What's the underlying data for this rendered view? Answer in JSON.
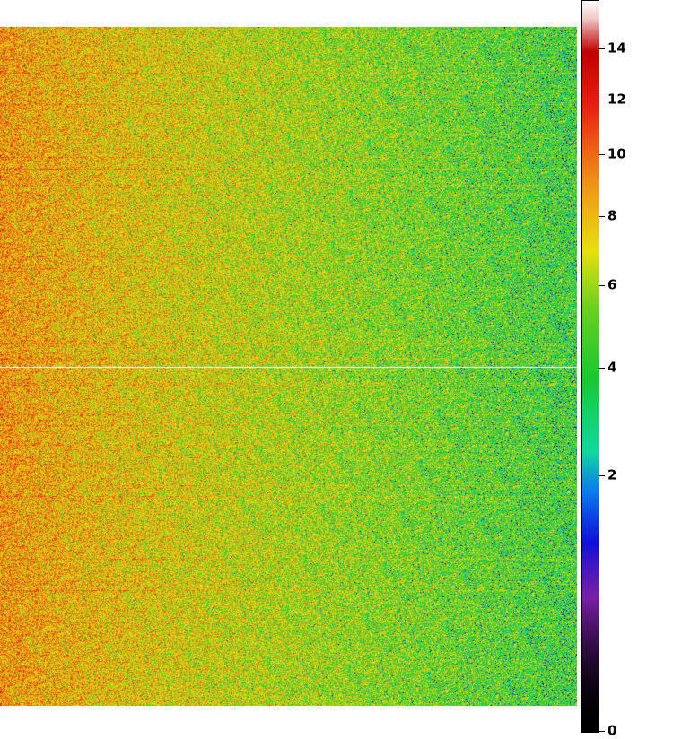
{
  "chart_data": {
    "type": "heatmap",
    "title": "",
    "xlabel": "",
    "ylabel": "",
    "description_of_values": "Dense pixel heatmap; values are high (orange/yellow, ~7-9) on the left and decrease toward the right (green/cyan, ~3-5), with horizontal row striping and a bright white horizontal line near the vertical middle.",
    "colorbar": {
      "scale": "sqrt",
      "vmin": 0,
      "vmax": 15,
      "ticks": [
        "0",
        "2",
        "4",
        "6",
        "8",
        "10",
        "12",
        "14"
      ],
      "tick_values": [
        0,
        2,
        4,
        6,
        8,
        10,
        12,
        14
      ],
      "colormap_stops": [
        {
          "value": 0,
          "color": "#000000"
        },
        {
          "value": 0.5,
          "color": "#7a1fa8"
        },
        {
          "value": 1.0,
          "color": "#1010d8"
        },
        {
          "value": 1.6,
          "color": "#0a78f0"
        },
        {
          "value": 2.2,
          "color": "#12d8a0"
        },
        {
          "value": 3.5,
          "color": "#18c830"
        },
        {
          "value": 5.0,
          "color": "#6ad020"
        },
        {
          "value": 6.5,
          "color": "#e8e010"
        },
        {
          "value": 8.5,
          "color": "#f09018"
        },
        {
          "value": 11.0,
          "color": "#e82010"
        },
        {
          "value": 13.0,
          "color": "#c00000"
        },
        {
          "value": 14.3,
          "color": "#f0c8c8"
        },
        {
          "value": 15.0,
          "color": "#ffffff"
        }
      ]
    },
    "row_profile": {
      "left_mean": 8.3,
      "right_mean": 3.9,
      "noise_std": 1.6,
      "bright_line_row_fraction": 0.5
    }
  }
}
